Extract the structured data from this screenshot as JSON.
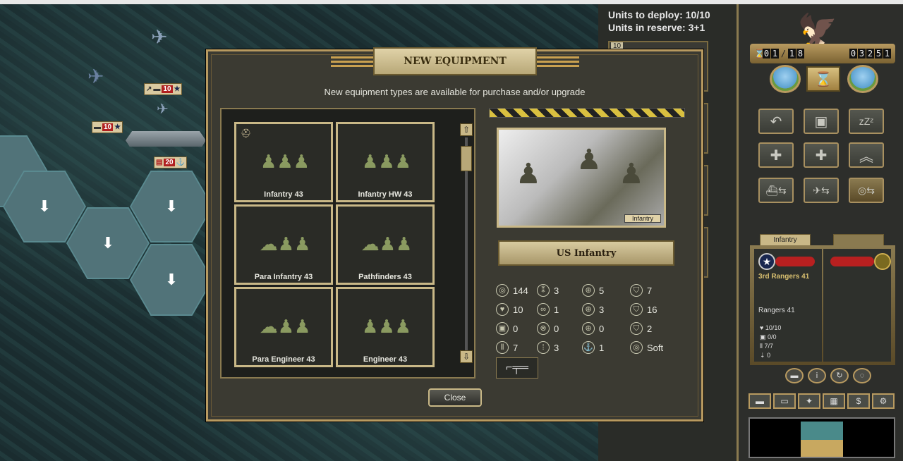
{
  "deploy": {
    "units_to_deploy": "Units to deploy: 10/10",
    "units_in_reserve": "Units in reserve: 3+1",
    "slot_number": "10"
  },
  "map": {
    "tags": [
      {
        "value": "10",
        "flag": "star"
      },
      {
        "value": "10",
        "flag": "star"
      },
      {
        "value": "20",
        "flag": "us-flag"
      }
    ]
  },
  "dialog": {
    "title": "NEW EQUIPMENT",
    "subtitle": "New equipment types are available for purchase and/or upgrade",
    "units": [
      {
        "label": "Infantry 43"
      },
      {
        "label": "Infantry HW 43"
      },
      {
        "label": "Para Infantry 43"
      },
      {
        "label": "Pathfinders 43"
      },
      {
        "label": "Para Engineer 43"
      },
      {
        "label": "Engineer 43"
      }
    ],
    "photo_caption": "Infantry",
    "unit_name": "US Infantry",
    "stats": [
      {
        "icon": "coins-icon",
        "value": "144"
      },
      {
        "icon": "footsteps-icon",
        "value": "3"
      },
      {
        "icon": "soft-attack-icon",
        "value": "5"
      },
      {
        "icon": "ground-defense-icon",
        "value": "7"
      },
      {
        "icon": "heart-icon",
        "value": "10"
      },
      {
        "icon": "binoculars-icon",
        "value": "1"
      },
      {
        "icon": "hard-attack-icon",
        "value": "3"
      },
      {
        "icon": "air-defense-icon",
        "value": "16"
      },
      {
        "icon": "fuel-icon",
        "value": "0"
      },
      {
        "icon": "spot-icon",
        "value": "0"
      },
      {
        "icon": "air-attack-icon",
        "value": "0"
      },
      {
        "icon": "close-defense-icon",
        "value": "2"
      },
      {
        "icon": "ammo-icon",
        "value": "7"
      },
      {
        "icon": "range-icon",
        "value": "3"
      },
      {
        "icon": "naval-attack-icon",
        "value": "1"
      },
      {
        "icon": "target-type-icon",
        "value": "Soft"
      }
    ],
    "close_label": "Close"
  },
  "hud": {
    "turn_digits": [
      "0",
      "1",
      "1",
      "8"
    ],
    "prestige_digits": [
      "0",
      "3",
      "2",
      "5",
      "1"
    ],
    "unit_tab": "Infantry",
    "unit": {
      "name": "3rd Rangers 41",
      "type": "Rangers 41",
      "strength": "10/10",
      "fuel": "0/0",
      "ammo": "7/7",
      "exp": "0"
    }
  },
  "colors": {
    "gold_trim": "#b89a60",
    "panel_dark": "#3b3a32",
    "hex_overlay": "#5a8a90"
  }
}
